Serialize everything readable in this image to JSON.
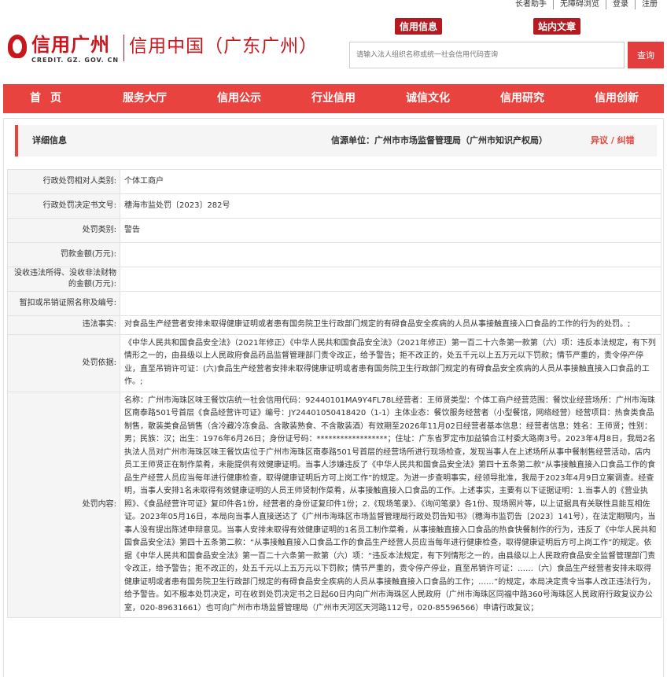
{
  "topbar": {
    "links": [
      "长者助手",
      "无障碍浏览",
      "登录",
      "注册"
    ]
  },
  "header": {
    "logo_cn": "信用广州",
    "logo_en": "CREDIT. GZ. GOV. CN",
    "site_name": "信用中国（广东广州）",
    "tag_credit_info": "信用信息",
    "tag_site_search": "站内文章",
    "search_placeholder": "请输入法人组织名称或统一社会信用代码查询",
    "search_button": "查询"
  },
  "nav": [
    "首页",
    "服务大厅",
    "信用公示",
    "行业信用",
    "诚信文化",
    "信用研究",
    "信用创新"
  ],
  "detail": {
    "title": "详细信息",
    "source": "信源单位：广州市市场监督管理局（广州市知识产权局）",
    "objection": "异议 / 纠错"
  },
  "rows": [
    {
      "label": "行政处罚相对人类别:",
      "value": "个体工商户"
    },
    {
      "label": "行政处罚决定书文号:",
      "value": "穗海市监处罚〔2023〕282号"
    },
    {
      "label": "处罚类别:",
      "value": "警告"
    },
    {
      "label": "罚款金额(万元):",
      "value": ""
    },
    {
      "label": "没收违法所得、没收非法财物的金额(万元):",
      "value": ""
    },
    {
      "label": "暂扣或吊销证照名称及编号:",
      "value": ""
    },
    {
      "label": "违法事实:",
      "value": "对食品生产经营者安排未取得健康证明或者患有国务院卫生行政部门规定的有碍食品安全疾病的人员从事接触直接入口食品的工作的行为的处罚。;"
    },
    {
      "label": "处罚依据:",
      "value": "《中华人民共和国食品安全法》（2021年修正）《中华人民共和国食品安全法》（2021年修正）第一百二十六条第一款第（六）项：违反本法规定，有下列情形之一的，由县级以上人民政府食品药品监督管理部门责令改正，给予警告；拒不改正的，处五千元以上五万元以下罚款；情节严重的，责令停产停业，直至吊销许可证：(六)食品生产经营者安排未取得健康证明或者患有国务院卫生行政部门规定的有碍食品安全疾病的人员从事接触直接入口食品的工作。;"
    },
    {
      "label": "处罚内容:",
      "value": "名称：广州市海珠区味王餐饮店统一社会信用代码：92440101MA9Y4FL78L经营者：王师贤类型：个体工商户经营范围：餐饮业经营场所：广州市海珠区南泰路501号首层《食品经营许可证》编号：JY24401050418420（1-1）主体业态：餐饮服务经营者（小型餐馆，网络经营）经营项目：热食类食品制售，散装类食品销售（含冷藏冷冻食品、含散装熟食、不含散装酒）有效期至2026年11月02日经营者基本信息：经营者信息：姓名：王师贤；性别：男；民族：汉；出生：1976年6月26日；身份证号码：******************；住址：广东省罗定市加益镇合江村委大路南3号。2023年4月8日，我局2名执法人员对广州市海珠区味王餐饮店位于广州市海珠区南泰路501号首层的经营场所进行现场检查，发现当事人在上述场所从事中餐制售经营活动，店内员工王师贤正在制作菜肴，未能提供有效健康证明。当事人涉嫌违反了《中华人民共和国食品安全法》第四十五条第二款“从事接触直接入口食品工作的食品生产经营人员应当每年进行健康检查，取得健康证明后方可上岗工作”的规定。为进一步查明事实，经领导批准，我局于2023年4月9日立案调查。经查明，当事人安排1名未取得有效健康证明的人员王师贤制作菜肴，从事接触直接入口食品的工作。上述事实，主要有以下证据证明：1.当事人的《营业执照》、《食品经营许可证》复印件各1份，经营者的身份证复印件1份；2.《现场笔录》、《询问笔录》各1份、现场照片等，以上证据具有关联性且能互相佐证。2023年05月16日，本局向当事人直接送达了《广州市海珠区市场监督管理局行政处罚告知书》（穗海市监罚告〔2023〕141号），在法定期限内，当事人没有提出陈述申辩意见。当事人安排未取得有效健康证明的1名员工制作菜肴，从事接触直接入口食品的热食快餐制作的行为，违反了《中华人民共和国食品安全法》第四十五条第二款：“从事接触直接入口食品工作的食品生产经营人员应当每年进行健康检查，取得健康证明后方可上岗工作”的规定。依据《中华人民共和国食品安全法》第一百二十六条第一款第（六）项：“违反本法规定，有下列情形之一的，由县级以上人民政府食品安全监督管理部门责令改正，给予警告；拒不改正的，处五千元以上五万元以下罚款；情节严重的，责令停产停业，直至吊销许可证：……（六）食品生产经营者安排未取得健康证明或者患有国务院卫生行政部门规定的有碍食品安全疾病的人员从事接触直接入口食品的工作；……”的规定，本局决定责令当事人改正违法行为，给予警告。如不服本处罚决定，可在收到处罚决定书之日起60日内向广州市海珠区人民政府（广州市海珠区同福中路360号海珠区人民政府行政复议办公室，020-89631661）也可向广州市市场监督管理局（广州市天河区天河路112号，020-85596566）申请行政复议；"
    }
  ]
}
